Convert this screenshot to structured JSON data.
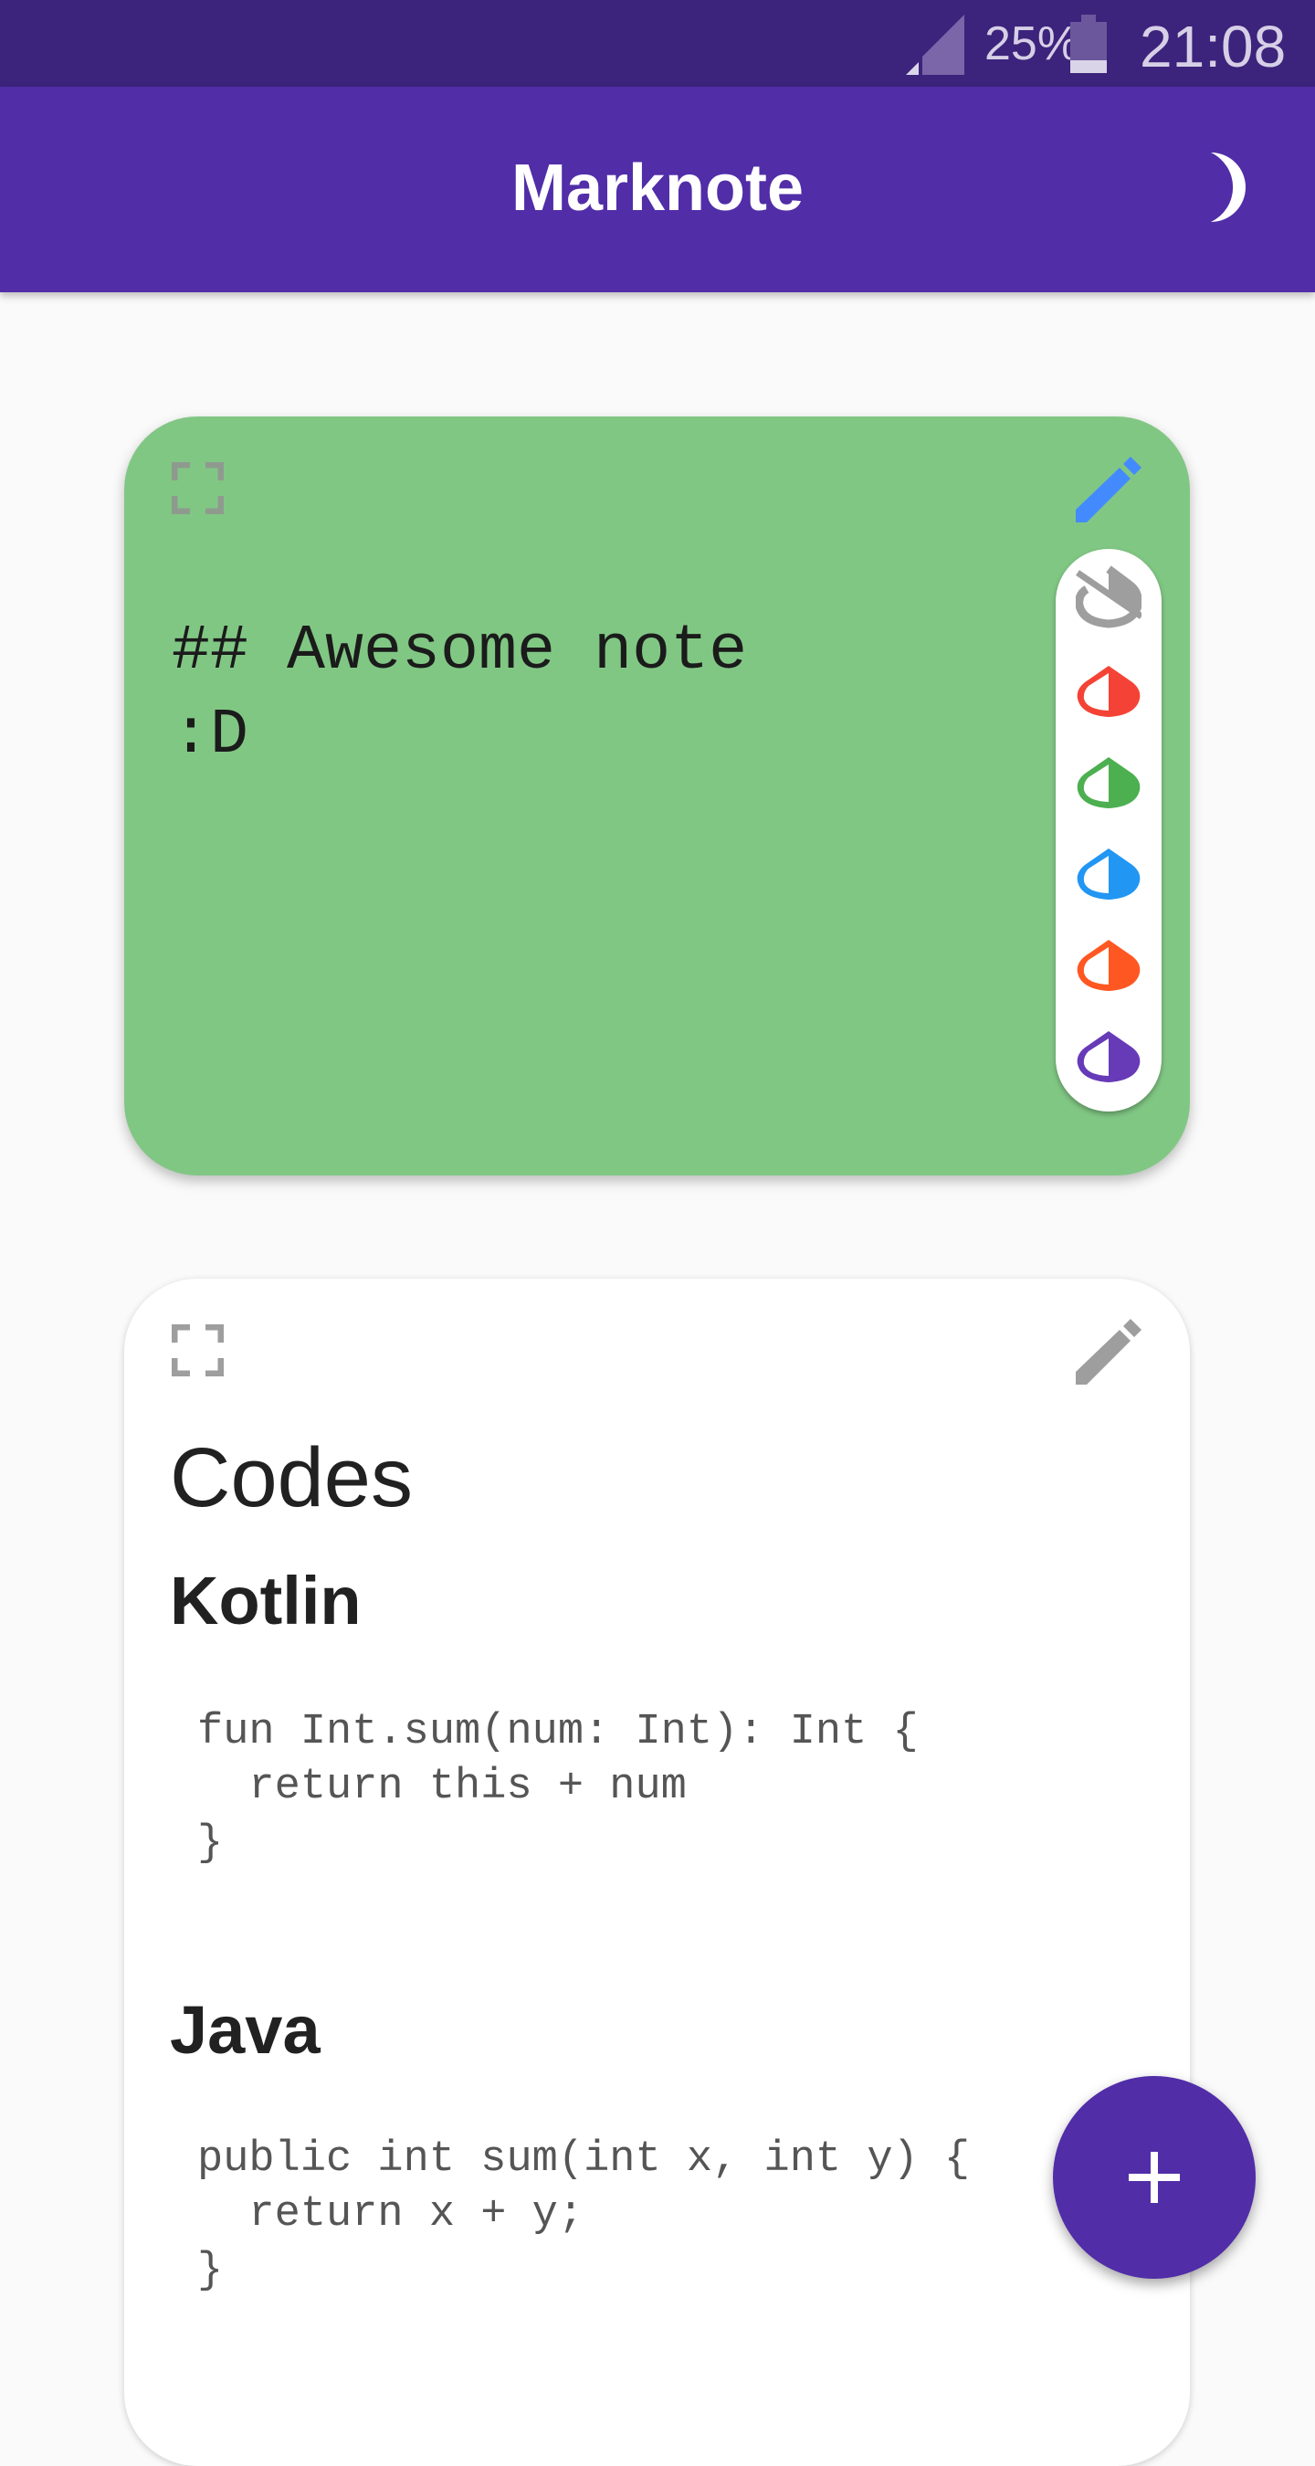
{
  "status_bar": {
    "battery": "25%",
    "time": "21:08"
  },
  "app_bar": {
    "title": "Marknote",
    "theme_icon": "moon-icon"
  },
  "notes": [
    {
      "color": "#81c784",
      "lines": [
        "## Awesome note",
        ":D"
      ],
      "palette": [
        {
          "name": "no-color",
          "color": "#9e9e9e"
        },
        {
          "name": "red",
          "color": "#f44336"
        },
        {
          "name": "green",
          "color": "#4caf50"
        },
        {
          "name": "blue",
          "color": "#2196f3"
        },
        {
          "name": "orange",
          "color": "#ff5722"
        },
        {
          "name": "purple",
          "color": "#673ab7"
        }
      ]
    },
    {
      "color": "#ffffff",
      "heading": "Codes",
      "sections": [
        {
          "title": "Kotlin",
          "code": [
            "fun Int.sum(num: Int): Int {",
            "  return this + num",
            "}"
          ]
        },
        {
          "title": "Java",
          "code": [
            "public int sum(int x, int y) {",
            "  return x + y;",
            "}"
          ]
        }
      ]
    }
  ],
  "fab": {
    "label": "+"
  }
}
